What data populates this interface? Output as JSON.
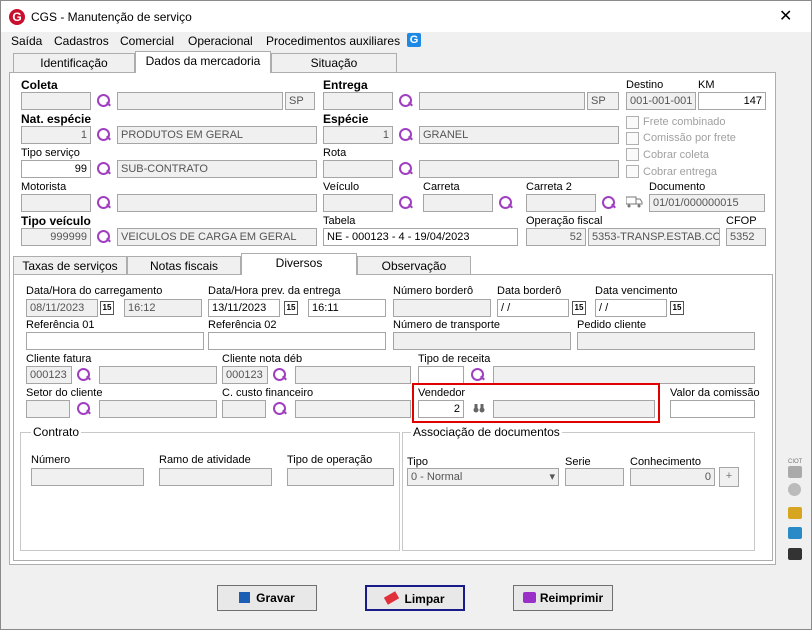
{
  "window": {
    "title": "CGS - Manutenção de serviço",
    "close_symbol": "✕",
    "app_logo_letter": "G"
  },
  "menu": [
    "Saída",
    "Cadastros",
    "Comercial",
    "Operacional",
    "Procedimentos auxiliares"
  ],
  "menu_icon_letter": "G",
  "top_tabs": [
    "Identificação",
    "Dados da mercadoria",
    "Situação"
  ],
  "top_tab_active": "Dados da mercadoria",
  "main": {
    "coleta_label": "Coleta",
    "coleta_code": "",
    "coleta_name": "",
    "coleta_uf": "SP",
    "entrega_label": "Entrega",
    "entrega_code": "",
    "entrega_name": "",
    "entrega_uf": "SP",
    "destino_label": "Destino",
    "destino_value": "001-001-001",
    "km_label": "KM",
    "km_value": "147",
    "nat_especie_label": "Nat. espécie",
    "nat_especie_code": "1",
    "nat_especie_name": "PRODUTOS EM GERAL",
    "especie_label": "Espécie",
    "especie_code": "1",
    "especie_name": "GRANEL",
    "frete_combinado": "Frete combinado",
    "comissao_por_frete": "Comissão por frete",
    "cobrar_coleta": "Cobrar coleta",
    "cobrar_entrega": "Cobrar entrega",
    "tipo_servico_label": "Tipo serviço",
    "tipo_servico_code": "99",
    "tipo_servico_name": "SUB-CONTRATO",
    "rota_label": "Rota",
    "motorista_label": "Motorista",
    "veiculo_label": "Veículo",
    "carreta_label": "Carreta",
    "carreta2_label": "Carreta 2",
    "documento_label": "Documento",
    "documento_value": "01/01/000000015",
    "tipo_veiculo_label": "Tipo veículo",
    "tipo_veiculo_code": "999999",
    "tipo_veiculo_name": "VEICULOS DE CARGA EM GERAL",
    "tabela_label": "Tabela",
    "tabela_value": "NE - 000123 - 4 - 19/04/2023",
    "operacao_fiscal_label": "Operação fiscal",
    "operacao_fiscal_code": "52",
    "operacao_fiscal_name": "5353-TRANSP.ESTAB.CO",
    "cfop_label": "CFOP",
    "cfop_value": "5352"
  },
  "sub_tabs": [
    "Taxas de serviços",
    "Notas fiscais",
    "Diversos",
    "Observação"
  ],
  "sub_tab_active": "Diversos",
  "diversos": {
    "data_carregamento_label": "Data/Hora do carregamento",
    "data_carregamento_date": "08/11/2023",
    "data_carregamento_time": "16:12",
    "data_entrega_label": "Data/Hora prev. da entrega",
    "data_entrega_date": "13/11/2023",
    "data_entrega_time": "16:11",
    "numero_bordero_label": "Número borderô",
    "data_bordero_label": "Data borderô",
    "data_bordero_value": " /  /",
    "data_vencimento_label": "Data vencimento",
    "data_vencimento_value": " /  /",
    "referencia01_label": "Referência 01",
    "referencia02_label": "Referência 02",
    "numero_transporte_label": "Número de transporte",
    "pedido_cliente_label": "Pedido cliente",
    "cliente_fatura_label": "Cliente fatura",
    "cliente_fatura_code": "000123",
    "cliente_nota_label": "Cliente nota déb",
    "cliente_nota_code": "000123",
    "tipo_receita_label": "Tipo de receita",
    "setor_cliente_label": "Setor do cliente",
    "custo_financeiro_label": "C. custo financeiro",
    "vendedor_label": "Vendedor",
    "vendedor_code": "2",
    "vendedor_name": "",
    "valor_comissao_label": "Valor da comissão",
    "contrato_title": "Contrato",
    "numero_label": "Número",
    "ramo_label": "Ramo de atividade",
    "tipo_operacao_label": "Tipo de operação",
    "assoc_title": "Associação de documentos",
    "tipo_label": "Tipo",
    "tipo_value": "0 - Normal",
    "serie_label": "Serie",
    "conhecimento_label": "Conhecimento",
    "conhecimento_value": "0"
  },
  "side_label": "CIOT",
  "buttons": {
    "gravar": "Gravar",
    "limpar": "Limpar",
    "reimprimir": "Reimprimir"
  },
  "calendar_glyph": "15",
  "plus_glyph": "+",
  "dropdown_glyph": "▾",
  "colors": {
    "highlight": "#e00000",
    "magnifier": "#a040c0",
    "logo": "#c8102e"
  }
}
